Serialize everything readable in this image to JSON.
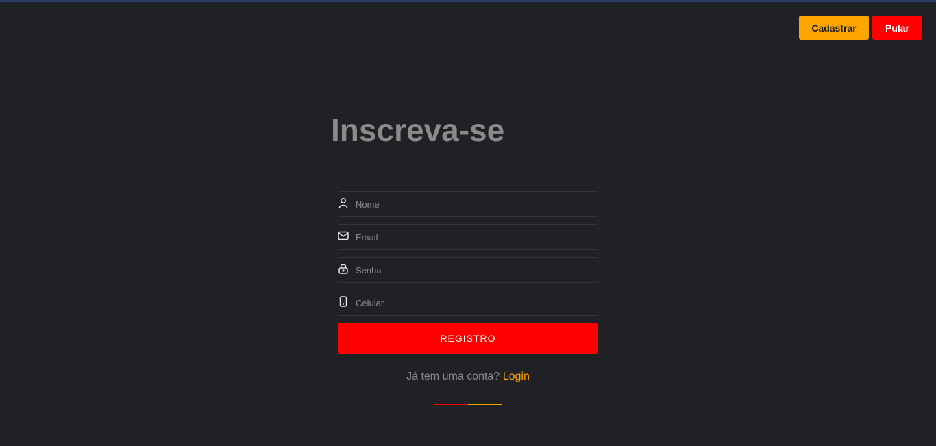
{
  "header": {
    "cadastrar_label": "Cadastrar",
    "pular_label": "Pular"
  },
  "form": {
    "title": "Inscreva-se",
    "fields": [
      {
        "placeholder": "Nome",
        "icon": "user-icon"
      },
      {
        "placeholder": "Email",
        "icon": "mail-icon"
      },
      {
        "placeholder": "Senha",
        "icon": "lock-icon"
      },
      {
        "placeholder": "Celular",
        "icon": "phone-icon"
      }
    ],
    "submit_label": "REGISTRO",
    "login_prompt": "Já tem uma conta?",
    "login_link": "Login"
  },
  "colors": {
    "background": "#202125",
    "accent_orange": "#ffa500",
    "accent_red": "#ff0000",
    "muted_text": "#8a8a8a"
  }
}
